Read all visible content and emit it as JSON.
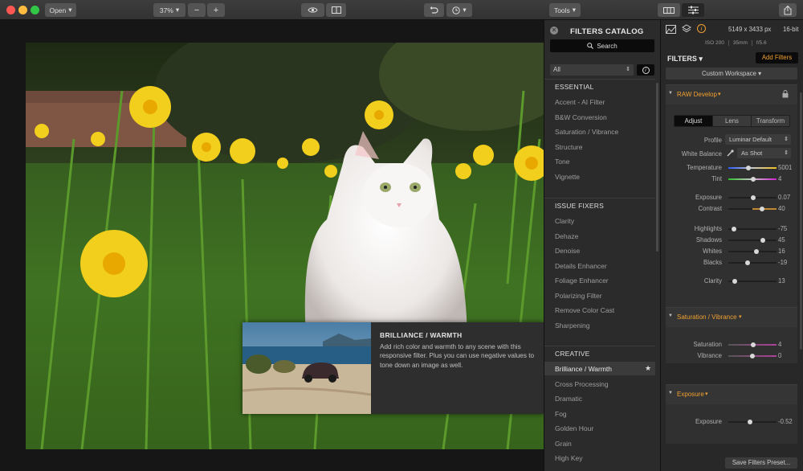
{
  "toolbar": {
    "open_label": "Open",
    "zoom_label": "37%",
    "zoom_out": "−",
    "zoom_in": "+",
    "tools_label": "Tools"
  },
  "catalog": {
    "title": "FILTERS CATALOG",
    "search_label": "Search",
    "category_select": "All",
    "sections": [
      {
        "title": "ESSENTIAL",
        "items": [
          "Accent - AI Filter",
          "B&W Conversion",
          "Saturation / Vibrance",
          "Structure",
          "Tone",
          "Vignette"
        ]
      },
      {
        "title": "ISSUE FIXERS",
        "items": [
          "Clarity",
          "Dehaze",
          "Denoise",
          "Details Enhancer",
          "Foliage Enhancer",
          "Polarizing Filter",
          "Remove Color Cast",
          "Sharpening"
        ]
      },
      {
        "title": "CREATIVE",
        "items": [
          "Brilliance / Warmth",
          "Cross Processing",
          "Dramatic",
          "Fog",
          "Golden Hour",
          "Grain",
          "High Key"
        ]
      }
    ],
    "selected_item": "Brilliance / Warmth",
    "star": "★"
  },
  "tooltip": {
    "title": "BRILLIANCE / WARMTH",
    "body": "Add rich color and warmth to any scene with this responsive filter. Plus you can use negative values to tone down an image as well."
  },
  "sidebar": {
    "dimensions": "5149 x 3433 px",
    "bit_depth": "16-bit",
    "meta": [
      "ISO 200",
      "35mm",
      "f/5.6"
    ],
    "filters_label": "FILTERS",
    "add_filters": "Add Filters",
    "workspace": "Custom Workspace",
    "raw": {
      "title": "RAW Develop",
      "tabs": [
        "Adjust",
        "Lens",
        "Transform"
      ],
      "profile_label": "Profile",
      "profile_value": "Luminar Default",
      "wb_label": "White Balance",
      "wb_value": "As Shot",
      "sliders": [
        {
          "label": "Temperature",
          "value": "5001",
          "pos": 0.42
        },
        {
          "label": "Tint",
          "value": "4",
          "pos": 0.52
        },
        {
          "label": "Exposure",
          "value": "0.07",
          "pos": 0.52
        },
        {
          "label": "Contrast",
          "value": "40",
          "pos": 0.7
        },
        {
          "label": "Highlights",
          "value": "-75",
          "pos": 0.12
        },
        {
          "label": "Shadows",
          "value": "45",
          "pos": 0.72
        },
        {
          "label": "Whites",
          "value": "16",
          "pos": 0.58
        },
        {
          "label": "Blacks",
          "value": "-19",
          "pos": 0.4
        },
        {
          "label": "Clarity",
          "value": "13",
          "pos": 0.13
        }
      ]
    },
    "satvib": {
      "title": "Saturation / Vibrance",
      "sliders": [
        {
          "label": "Saturation",
          "value": "4",
          "pos": 0.52
        },
        {
          "label": "Vibrance",
          "value": "0",
          "pos": 0.5
        }
      ]
    },
    "exposure": {
      "title": "Exposure",
      "sliders": [
        {
          "label": "Exposure",
          "value": "-0.52",
          "pos": 0.45
        }
      ]
    },
    "save_preset": "Save Filters Preset..."
  }
}
